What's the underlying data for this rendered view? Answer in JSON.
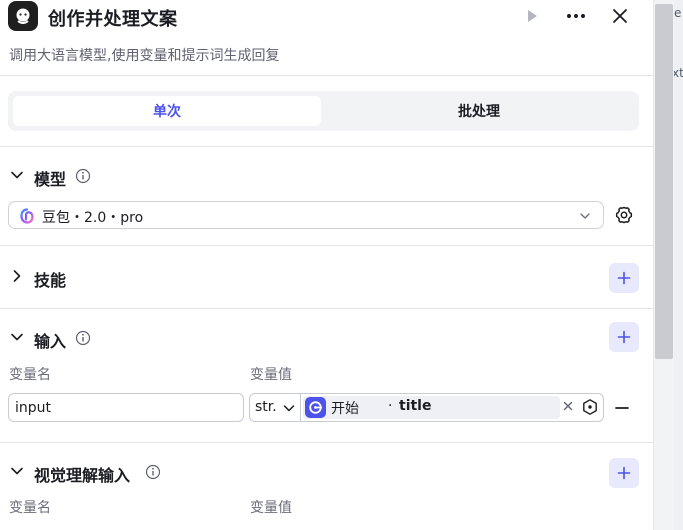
{
  "header": {
    "title": "创作并处理文案",
    "subtitle": "调用大语言模型,使用变量和提示词生成回复"
  },
  "tabs": [
    {
      "label": "单次",
      "active": true
    },
    {
      "label": "批处理",
      "active": false
    }
  ],
  "sections": {
    "model": {
      "title": "模型",
      "selected": "豆包・2.0・pro"
    },
    "skills": {
      "title": "技能"
    },
    "input": {
      "title": "输入",
      "col_name": "变量名",
      "col_value": "变量值",
      "row": {
        "name": "input",
        "type": "str.",
        "ref_source": "开始",
        "ref_sep": "·",
        "ref_var": "title"
      }
    },
    "vision": {
      "title": "视觉理解输入",
      "col_name": "变量名",
      "col_value": "变量值"
    }
  },
  "canvas_fragments": [
    "e",
    "xt"
  ],
  "colors": {
    "accent": "#4d53e8",
    "accent_soft": "#e8e9fd",
    "border": "#e5e6eb",
    "app_icon_bg": "#1f1f1f"
  }
}
